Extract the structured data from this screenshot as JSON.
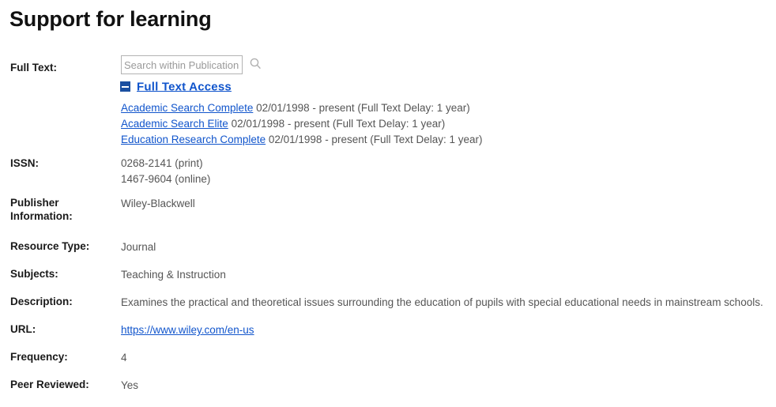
{
  "page_title": "Support for learning",
  "colors": {
    "link": "#1155cc",
    "toggle": "#1b4fa0",
    "label": "#1a1a1a",
    "value": "#555555"
  },
  "full_text": {
    "label": "Full Text:",
    "search": {
      "placeholder": "Search within Publication",
      "value": "",
      "icon": "search-icon"
    },
    "toggle_icon": "minus-square-icon",
    "access_link": "Full Text Access",
    "databases": [
      {
        "name": "Academic Search Complete",
        "coverage": "02/01/1998 - present (Full Text Delay: 1 year)"
      },
      {
        "name": "Academic Search Elite",
        "coverage": "02/01/1998 - present (Full Text Delay: 1 year)"
      },
      {
        "name": "Education Research Complete",
        "coverage": "02/01/1998 - present (Full Text Delay: 1 year)"
      }
    ]
  },
  "issn": {
    "label": "ISSN:",
    "print": "0268-2141 (print)",
    "online": "1467-9604 (online)"
  },
  "publisher": {
    "label_line1": "Publisher",
    "label_line2": "Information:",
    "value": "Wiley-Blackwell"
  },
  "resource_type": {
    "label": "Resource Type:",
    "value": "Journal"
  },
  "subjects": {
    "label": "Subjects:",
    "value": "Teaching & Instruction"
  },
  "description": {
    "label": "Description:",
    "value": "Examines the practical and theoretical issues surrounding the education of pupils with special educational needs in mainstream schools."
  },
  "url": {
    "label": "URL:",
    "value": "https://www.wiley.com/en-us"
  },
  "frequency": {
    "label": "Frequency:",
    "value": "4"
  },
  "peer_reviewed": {
    "label": "Peer Reviewed:",
    "value": "Yes"
  }
}
